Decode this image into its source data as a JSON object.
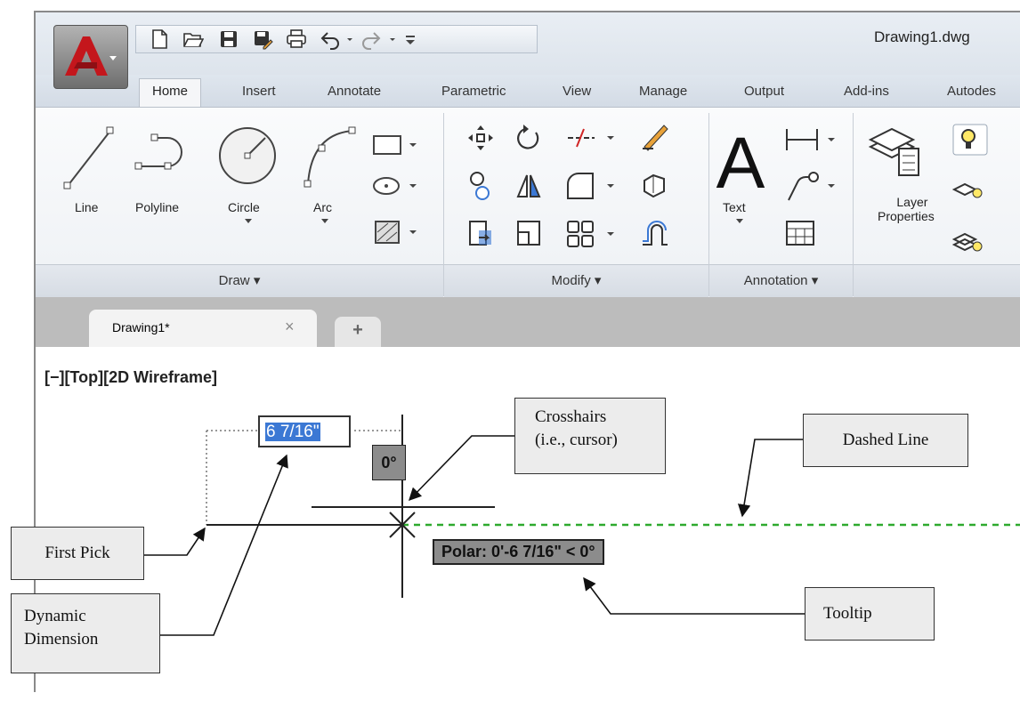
{
  "window": {
    "title": "Drawing1.dwg"
  },
  "ribbon_tabs": [
    "Home",
    "Insert",
    "Annotate",
    "Parametric",
    "View",
    "Manage",
    "Output",
    "Add-ins",
    "Autodes"
  ],
  "draw_panel": {
    "title": "Draw",
    "tools": [
      "Line",
      "Polyline",
      "Circle",
      "Arc"
    ]
  },
  "modify_panel": {
    "title": "Modify"
  },
  "annotation_panel": {
    "title": "Annotation",
    "text_label": "Text"
  },
  "layers_panel": {
    "layer_properties_label": "Layer Properties"
  },
  "document_tab": {
    "name": "Drawing1*",
    "close": "×",
    "new_tab": "+"
  },
  "viewport": {
    "label": "[−][Top][2D Wireframe]"
  },
  "dynamic_input": {
    "value": "6 7/16\"",
    "angle": "0°"
  },
  "tooltip": {
    "text": "Polar: 0'-6 7/16\" < 0°"
  },
  "callouts": {
    "crosshairs": [
      "Crosshairs",
      "(i.e., cursor)"
    ],
    "dashed_line": "Dashed Line",
    "first_pick": "First Pick",
    "dynamic_dimension": [
      "Dynamic",
      "Dimension"
    ],
    "tooltip": "Tooltip"
  },
  "colors": {
    "accent": "#3b78d4",
    "app_red": "#c4161c",
    "dashed_line": "#2eaa2e"
  }
}
